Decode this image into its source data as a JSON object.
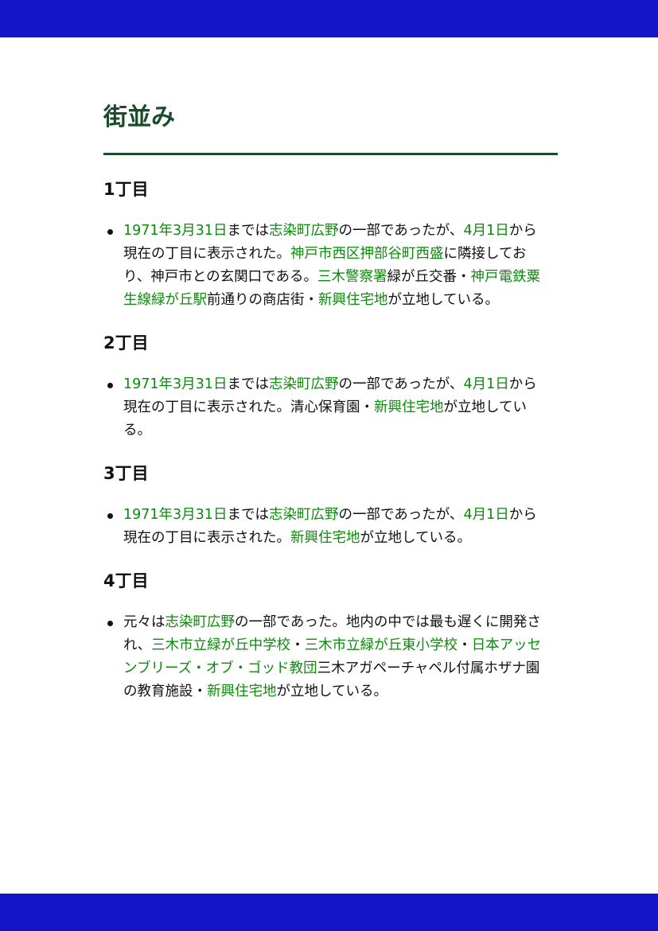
{
  "page": {
    "title": "街並み",
    "colors": {
      "band": "#1414c8",
      "title": "#1b4d2b",
      "link": "#0c8a0c",
      "text": "#111111"
    }
  },
  "sections": [
    {
      "heading": "1丁目",
      "segments": [
        {
          "text": "1971年3月31日",
          "link": true
        },
        {
          "text": "までは",
          "link": false
        },
        {
          "text": "志染町広野",
          "link": true
        },
        {
          "text": "の一部であったが、",
          "link": false
        },
        {
          "text": "4月1日",
          "link": true
        },
        {
          "text": "から現在の丁目に表示された。",
          "link": false
        },
        {
          "text": "神戸市西区押部谷町西盛",
          "link": true
        },
        {
          "text": "に隣接しており、神戸市との玄関口である。",
          "link": false
        },
        {
          "text": "三木警察署",
          "link": true
        },
        {
          "text": "緑が丘交番・",
          "link": false
        },
        {
          "text": "神戸電鉄粟生線緑が丘駅",
          "link": true
        },
        {
          "text": "前通りの商店街・",
          "link": false
        },
        {
          "text": "新興住宅地",
          "link": true
        },
        {
          "text": "が立地している。",
          "link": false
        }
      ]
    },
    {
      "heading": "2丁目",
      "segments": [
        {
          "text": "1971年3月31日",
          "link": true
        },
        {
          "text": "までは",
          "link": false
        },
        {
          "text": "志染町広野",
          "link": true
        },
        {
          "text": "の一部であったが、",
          "link": false
        },
        {
          "text": "4月1日",
          "link": true
        },
        {
          "text": "から現在の丁目に表示された。清心保育園・",
          "link": false
        },
        {
          "text": "新興住宅地",
          "link": true
        },
        {
          "text": "が立地している。",
          "link": false
        }
      ]
    },
    {
      "heading": "3丁目",
      "segments": [
        {
          "text": "1971年3月31日",
          "link": true
        },
        {
          "text": "までは",
          "link": false
        },
        {
          "text": "志染町広野",
          "link": true
        },
        {
          "text": "の一部であったが、",
          "link": false
        },
        {
          "text": "4月1日",
          "link": true
        },
        {
          "text": "から現在の丁目に表示された。",
          "link": false
        },
        {
          "text": "新興住宅地",
          "link": true
        },
        {
          "text": "が立地している。",
          "link": false
        }
      ]
    },
    {
      "heading": "4丁目",
      "segments": [
        {
          "text": "元々は",
          "link": false
        },
        {
          "text": "志染町広野",
          "link": true
        },
        {
          "text": "の一部であった。地内の中では最も遅くに開発され、",
          "link": false
        },
        {
          "text": "三木市立緑が丘中学校",
          "link": true
        },
        {
          "text": "・",
          "link": false
        },
        {
          "text": "三木市立緑が丘東小学校",
          "link": true
        },
        {
          "text": "・",
          "link": false
        },
        {
          "text": "日本アッセンブリーズ・オブ・ゴッド教団",
          "link": true
        },
        {
          "text": "三木アガペーチャペル付属ホザナ園の教育施設・",
          "link": false
        },
        {
          "text": "新興住宅地",
          "link": true
        },
        {
          "text": "が立地している。",
          "link": false
        }
      ]
    }
  ]
}
